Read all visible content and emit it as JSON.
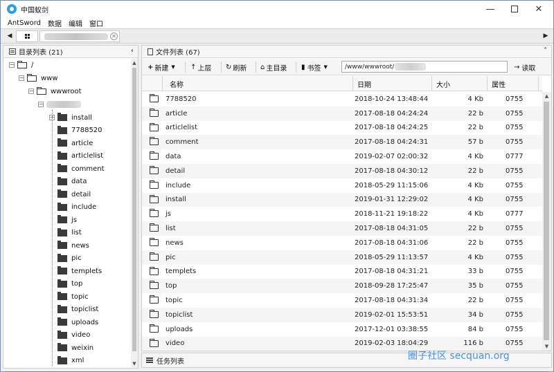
{
  "window": {
    "title": "中国蚁剑"
  },
  "menu": [
    "AntSword",
    "数据",
    "编辑",
    "窗口"
  ],
  "left_panel": {
    "title": "目录列表 (21)",
    "tree": {
      "root": "/",
      "level1": "www",
      "level2": "wwwroot",
      "folders": [
        "install",
        "7788520",
        "article",
        "articlelist",
        "comment",
        "data",
        "detail",
        "include",
        "js",
        "list",
        "news",
        "pic",
        "templets",
        "top",
        "topic",
        "topiclist",
        "uploads",
        "video",
        "weixin",
        "xml"
      ]
    }
  },
  "right_panel": {
    "title": "文件列表 (67)",
    "toolbar": {
      "new": "新建",
      "up": "上层",
      "refresh": "刷新",
      "home": "主目录",
      "bookmark": "书签",
      "path": "/www/wwwroot/",
      "read": "读取"
    },
    "columns": {
      "name": "名称",
      "date": "日期",
      "size": "大小",
      "perm": "属性"
    },
    "rows": [
      {
        "name": "7788520",
        "date": "2018-10-24 13:48:44",
        "size": "4 Kb",
        "perm": "0755"
      },
      {
        "name": "article",
        "date": "2017-08-18 04:24:24",
        "size": "22 b",
        "perm": "0755"
      },
      {
        "name": "articlelist",
        "date": "2017-08-18 04:24:25",
        "size": "22 b",
        "perm": "0755"
      },
      {
        "name": "comment",
        "date": "2017-08-18 04:24:31",
        "size": "57 b",
        "perm": "0755"
      },
      {
        "name": "data",
        "date": "2019-02-07 02:00:32",
        "size": "4 Kb",
        "perm": "0777"
      },
      {
        "name": "detail",
        "date": "2017-08-18 04:30:12",
        "size": "22 b",
        "perm": "0755"
      },
      {
        "name": "include",
        "date": "2018-05-29 11:15:06",
        "size": "4 Kb",
        "perm": "0755"
      },
      {
        "name": "install",
        "date": "2019-01-31 12:29:02",
        "size": "4 Kb",
        "perm": "0755"
      },
      {
        "name": "js",
        "date": "2018-11-21 19:18:22",
        "size": "4 Kb",
        "perm": "0777"
      },
      {
        "name": "list",
        "date": "2017-08-18 04:31:05",
        "size": "22 b",
        "perm": "0755"
      },
      {
        "name": "news",
        "date": "2017-08-18 04:31:06",
        "size": "22 b",
        "perm": "0755"
      },
      {
        "name": "pic",
        "date": "2018-05-29 11:13:57",
        "size": "4 Kb",
        "perm": "0755"
      },
      {
        "name": "templets",
        "date": "2017-08-18 04:31:21",
        "size": "33 b",
        "perm": "0755"
      },
      {
        "name": "top",
        "date": "2018-09-28 17:25:47",
        "size": "35 b",
        "perm": "0755"
      },
      {
        "name": "topic",
        "date": "2017-08-18 04:31:34",
        "size": "22 b",
        "perm": "0755"
      },
      {
        "name": "topiclist",
        "date": "2019-02-01 15:53:51",
        "size": "34 b",
        "perm": "0755"
      },
      {
        "name": "uploads",
        "date": "2017-12-01 03:38:55",
        "size": "84 b",
        "perm": "0755"
      },
      {
        "name": "video",
        "date": "2019-02-03 18:04:29",
        "size": "116 b",
        "perm": "0755"
      }
    ]
  },
  "task_panel": {
    "title": "任务列表"
  },
  "watermark": "圈子社区 secquan.org"
}
